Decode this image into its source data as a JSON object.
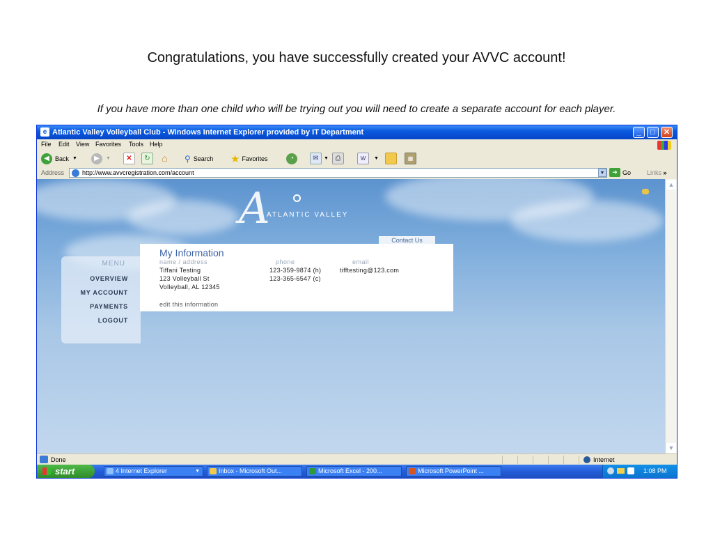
{
  "slide": {
    "title": "Congratulations, you have successfully created your AVVC account!",
    "subtitle": "If you have more than one child who will be trying out you will need to create a separate account for each player."
  },
  "window": {
    "title": "Atlantic Valley Volleyball Club - Windows Internet Explorer provided by IT Department",
    "menu": [
      "File",
      "Edit",
      "View",
      "Favorites",
      "Tools",
      "Help"
    ],
    "toolbar": {
      "back_label": "Back",
      "search_label": "Search",
      "favorites_label": "Favorites"
    },
    "address": {
      "label": "Address",
      "url": "http://www.avvcregistration.com/account",
      "go_label": "Go",
      "links_label": "Links"
    },
    "status": {
      "text": "Done",
      "zone": "Internet"
    }
  },
  "site": {
    "logo_text": "ATLANTIC VALLEY",
    "contact_label": "Contact Us",
    "menu_heading": "MENU",
    "menu_items": [
      "OVERVIEW",
      "MY ACCOUNT",
      "PAYMENTS",
      "LOGOUT"
    ],
    "info": {
      "title": "My Information",
      "col_name": "name / address",
      "col_phone": "phone",
      "col_email": "email",
      "name_lines": [
        "Tiffani Testing",
        "123 Volleyball St",
        "Volleyball, AL 12345"
      ],
      "phone_lines": [
        "123-359-9874 (h)",
        "123-365-6547 (c)"
      ],
      "email": "tifftesting@123.com",
      "edit_label": "edit this information"
    }
  },
  "taskbar": {
    "start_label": "start",
    "tasks": [
      "4 Internet Explorer",
      "Inbox - Microsoft Out...",
      "Microsoft Excel - 200...",
      "Microsoft PowerPoint ..."
    ],
    "clock": "1:08 PM"
  },
  "colors": {
    "titlebar": "#0a5ae0",
    "accent": "#3d62a6",
    "taskbar": "#245edb",
    "start": "#3a9a34"
  }
}
